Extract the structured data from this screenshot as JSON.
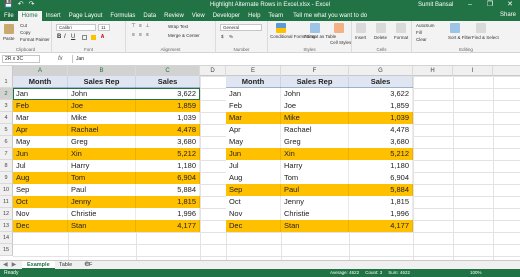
{
  "titlebar": {
    "title": "Highlight Alternate Rows in Excel.xlsx - Excel",
    "user": "Sumit Bansal",
    "qat_icons": [
      "save-icon",
      "undo-icon",
      "redo-icon"
    ]
  },
  "ribbon_tabs": [
    "File",
    "Home",
    "Insert",
    "Page Layout",
    "Formulas",
    "Data",
    "Review",
    "View",
    "Developer",
    "Help",
    "Team"
  ],
  "active_tab": "Home",
  "tell_me": "Tell me what you want to do",
  "share": "Share",
  "ribbon": {
    "clipboard": {
      "label": "Clipboard",
      "paste": "Paste",
      "cut": "Cut",
      "copy": "Copy",
      "format_painter": "Format Painter"
    },
    "font": {
      "label": "Font",
      "font_name": "Calibri",
      "font_size": "11",
      "bold": "B",
      "italic": "I",
      "underline": "U"
    },
    "alignment": {
      "label": "Alignment",
      "wrap_text": "Wrap Text",
      "merge_center": "Merge & Center"
    },
    "number": {
      "label": "Number",
      "format": "General",
      "currency": "$",
      "percent": "%"
    },
    "styles": {
      "label": "Styles",
      "conditional_formatting": "Conditional Formatting",
      "format_as_table": "Format as Table",
      "cell_styles": "Cell Styles"
    },
    "cells": {
      "label": "Cells",
      "insert": "Insert",
      "delete": "Delete",
      "format": "Format"
    },
    "editing": {
      "label": "Editing",
      "autosum": "AutoSum",
      "fill": "Fill",
      "clear": "Clear",
      "sort_filter": "Sort & Filter",
      "find_select": "Find & Select"
    }
  },
  "formula_bar": {
    "name_box": "2R x 3C",
    "fx": "fx",
    "content": "Jan"
  },
  "columns": [
    "A",
    "B",
    "C",
    "D",
    "E",
    "F",
    "G",
    "H",
    "I"
  ],
  "selected_columns": [
    "A",
    "B",
    "C"
  ],
  "rows": [
    "1",
    "2",
    "3",
    "4",
    "5",
    "6",
    "7",
    "8",
    "9",
    "10",
    "11",
    "12",
    "13",
    "14",
    "15"
  ],
  "selected_rows": [
    "2"
  ],
  "table_left": {
    "headers": [
      "Month",
      "Sales Rep",
      "Sales"
    ],
    "rows": [
      {
        "month": "Jan",
        "rep": "John",
        "sales": "3,622",
        "highlight": false
      },
      {
        "month": "Feb",
        "rep": "Joe",
        "sales": "1,859",
        "highlight": true
      },
      {
        "month": "Mar",
        "rep": "Mike",
        "sales": "1,039",
        "highlight": false
      },
      {
        "month": "Apr",
        "rep": "Rachael",
        "sales": "4,478",
        "highlight": true
      },
      {
        "month": "May",
        "rep": "Greg",
        "sales": "3,680",
        "highlight": false
      },
      {
        "month": "Jun",
        "rep": "Xin",
        "sales": "5,212",
        "highlight": true
      },
      {
        "month": "Jul",
        "rep": "Harry",
        "sales": "1,180",
        "highlight": false
      },
      {
        "month": "Aug",
        "rep": "Tom",
        "sales": "6,904",
        "highlight": true
      },
      {
        "month": "Sep",
        "rep": "Paul",
        "sales": "5,884",
        "highlight": false
      },
      {
        "month": "Oct",
        "rep": "Jenny",
        "sales": "1,815",
        "highlight": true
      },
      {
        "month": "Nov",
        "rep": "Christie",
        "sales": "1,996",
        "highlight": false
      },
      {
        "month": "Dec",
        "rep": "Stan",
        "sales": "4,177",
        "highlight": true
      }
    ]
  },
  "table_right": {
    "headers": [
      "Month",
      "Sales Rep",
      "Sales"
    ],
    "rows": [
      {
        "month": "Jan",
        "rep": "John",
        "sales": "3,622",
        "highlight": false
      },
      {
        "month": "Feb",
        "rep": "Joe",
        "sales": "1,859",
        "highlight": false
      },
      {
        "month": "Mar",
        "rep": "Mike",
        "sales": "1,039",
        "highlight": true
      },
      {
        "month": "Apr",
        "rep": "Rachael",
        "sales": "4,478",
        "highlight": false
      },
      {
        "month": "May",
        "rep": "Greg",
        "sales": "3,680",
        "highlight": false
      },
      {
        "month": "Jun",
        "rep": "Xin",
        "sales": "5,212",
        "highlight": true
      },
      {
        "month": "Jul",
        "rep": "Harry",
        "sales": "1,180",
        "highlight": false
      },
      {
        "month": "Aug",
        "rep": "Tom",
        "sales": "6,904",
        "highlight": false
      },
      {
        "month": "Sep",
        "rep": "Paul",
        "sales": "5,884",
        "highlight": true
      },
      {
        "month": "Oct",
        "rep": "Jenny",
        "sales": "1,815",
        "highlight": false
      },
      {
        "month": "Nov",
        "rep": "Christie",
        "sales": "1,996",
        "highlight": false
      },
      {
        "month": "Dec",
        "rep": "Stan",
        "sales": "4,177",
        "highlight": true
      }
    ]
  },
  "sheets": [
    "Example",
    "Table",
    "CF"
  ],
  "active_sheet": "Example",
  "statusbar": {
    "ready": "Ready",
    "average": "Average: 4622",
    "count": "Count: 3",
    "sum": "Sum: 4622",
    "zoom": "100%"
  },
  "colors": {
    "excel_green": "#217346",
    "highlight": "#ffc000",
    "header_fill": "#dfe6f1"
  }
}
